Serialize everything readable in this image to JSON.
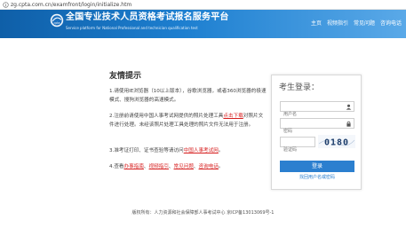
{
  "browser": {
    "url": "zg.cpta.com.cn/examfront/login/initialize.htm"
  },
  "header": {
    "title": "全国专业技术人员资格考试报名服务平台",
    "subtitle": "Service platform for National Professional and technician qualification test",
    "nav": [
      "主页",
      "视频指引",
      "常见问题",
      "咨询电话"
    ]
  },
  "tips": {
    "title": "友情提示",
    "line1": "1.请使用IE浏览器（10以上版本），谷歌浏览器，或者360浏览器的极速模式、搜狗浏览器的高速模式。",
    "line2_a": "2.注册前请使用中国人事考试网提供的照片处理工具",
    "line2_link": "点击下载",
    "line2_b": "对照片文件进行处理。未经该照片处理工具处理的照片文件无法用于注册。",
    "line3_a": "3.准考证打印、证书查验等请访问",
    "line3_link": "中国人事考试网",
    "line3_b": "。",
    "line4_a": "4.查看",
    "line4_link1": "办事指南",
    "line4_link2": "视频指引",
    "line4_link3": "常见问题",
    "line4_link4": "咨询电话",
    "sep": "、",
    "end": "。"
  },
  "login": {
    "title": "考生登录：",
    "username_placeholder": "用户名",
    "password_placeholder": "密码",
    "captcha_placeholder": "验证码",
    "captcha_text": "0180",
    "button": "登录",
    "forgot": "找回用户名或密码"
  },
  "footer": {
    "text": "版权所有：人力资源和社会保障部人事考试中心 京ICP备13013069号-1"
  },
  "colors": {
    "header_start": "#0f5fa8",
    "header_end": "#5aa9e8",
    "accent": "#2b7fcf",
    "link_red": "#d61f1f"
  }
}
